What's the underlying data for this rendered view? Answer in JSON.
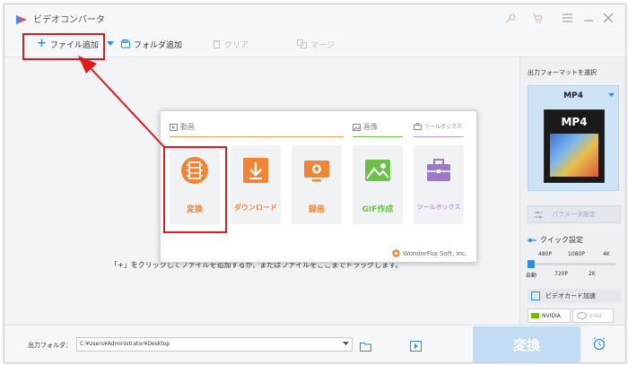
{
  "window": {
    "title": "ビデオコンバータ",
    "controls": [
      "key-icon",
      "cart-icon",
      "menu-icon",
      "minimize-icon",
      "close-icon"
    ]
  },
  "toolbar": {
    "add_file": "ファイル追加",
    "add_folder": "フォルダ追加",
    "clear": "クリア",
    "merge": "マージ"
  },
  "main": {
    "hint": "「+」をクリックしてファイルを追加するか、またはファイルをここまでドラッグします。"
  },
  "launcher": {
    "sections": {
      "video": "動画",
      "image": "画像",
      "toolbox": "ツールボックス"
    },
    "cards": [
      {
        "label": "変換",
        "icon": "film-reel-icon"
      },
      {
        "label": "ダウンロード",
        "icon": "download-icon"
      },
      {
        "label": "録画",
        "icon": "screen-record-icon"
      },
      {
        "label": "GIF作成",
        "icon": "image-landscape-icon"
      },
      {
        "label": "ツールボックス",
        "icon": "toolbox-icon"
      }
    ],
    "brand": "WonderFox Soft, Inc."
  },
  "right_panel": {
    "title": "出力フォーマットを選択",
    "format": "MP4",
    "format_badge": "MP4",
    "param_button": "パラメータ設定",
    "quick_label": "クイック設定",
    "slider_top": [
      "480P",
      "1080P",
      "4K"
    ],
    "slider_bottom": [
      "自動",
      "720P",
      "2K"
    ],
    "gpu_label": "ビデオカード加速",
    "nvidia": "NVIDIA",
    "intel": "Intel"
  },
  "bottom": {
    "output_label": "出力フォルダ：",
    "output_path": "C:¥Users¥Administrator¥Desktop",
    "convert": "変換"
  },
  "colors": {
    "accent_blue": "#2d8ee0",
    "orange": "#f08535",
    "green": "#6cc04a",
    "purple": "#9d79c8",
    "annotation_red": "#e01b1b"
  }
}
